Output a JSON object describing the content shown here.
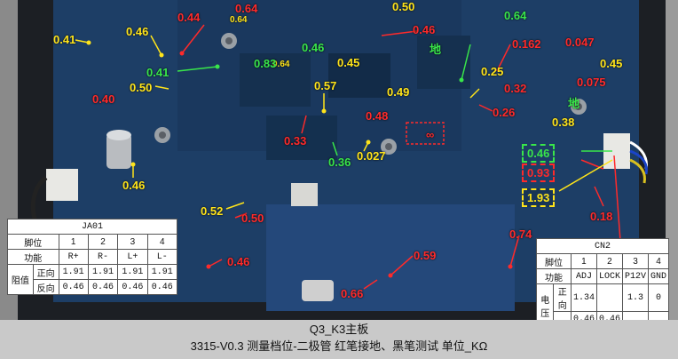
{
  "labels": {
    "red": [
      "0.44",
      "0.64",
      "0.46",
      "0.162",
      "0.047",
      "0.40",
      "0.32",
      "0.26",
      "0.075",
      "0.48",
      "0.33",
      "0.93",
      "0.18",
      "0.50",
      "0.46",
      "0.59",
      "0.66",
      "0.74",
      "∞"
    ],
    "yellow": [
      "0.46",
      "0.41",
      "0.50",
      "0.50",
      "0.64",
      "0.64",
      "0.45",
      "0.57",
      "0.49",
      "0.38",
      "0.45",
      "0.25",
      "0.027",
      "0.46",
      "0.52",
      "0.50"
    ],
    "green": [
      "0.64",
      "0.46",
      "0.41",
      "0.83",
      "0.36",
      "地",
      "地"
    ],
    "boxed_green": "0.46",
    "boxed_red": "0.93",
    "boxed_yellow": "1.93"
  },
  "ja01": {
    "title": "JA01",
    "row_pin": [
      "脚位",
      "1",
      "2",
      "3",
      "4"
    ],
    "row_func": [
      "功能",
      "R+",
      "R-",
      "L+",
      "L-"
    ],
    "group": "阻值",
    "row_fwd": [
      "正向",
      "1.91",
      "1.91",
      "1.91",
      "1.91"
    ],
    "row_rev": [
      "反向",
      "0.46",
      "0.46",
      "0.46",
      "0.46"
    ]
  },
  "cn2": {
    "title": "CN2",
    "row_pin": [
      "脚位",
      "1",
      "2",
      "3",
      "4"
    ],
    "row_func": [
      "功能",
      "ADJ",
      "LOCK",
      "P12V",
      "GND"
    ],
    "group": "电压",
    "row_fwd": [
      "正向",
      "1.34",
      "",
      "1.3",
      "0"
    ],
    "row_rev": [
      "",
      "0.46",
      "0.46",
      "",
      ""
    ]
  },
  "caption": {
    "line1": "Q3_K3主板",
    "line2": "3315-V0.3 测量档位-二极管    红笔接地、黑笔测试  单位_KΩ"
  }
}
